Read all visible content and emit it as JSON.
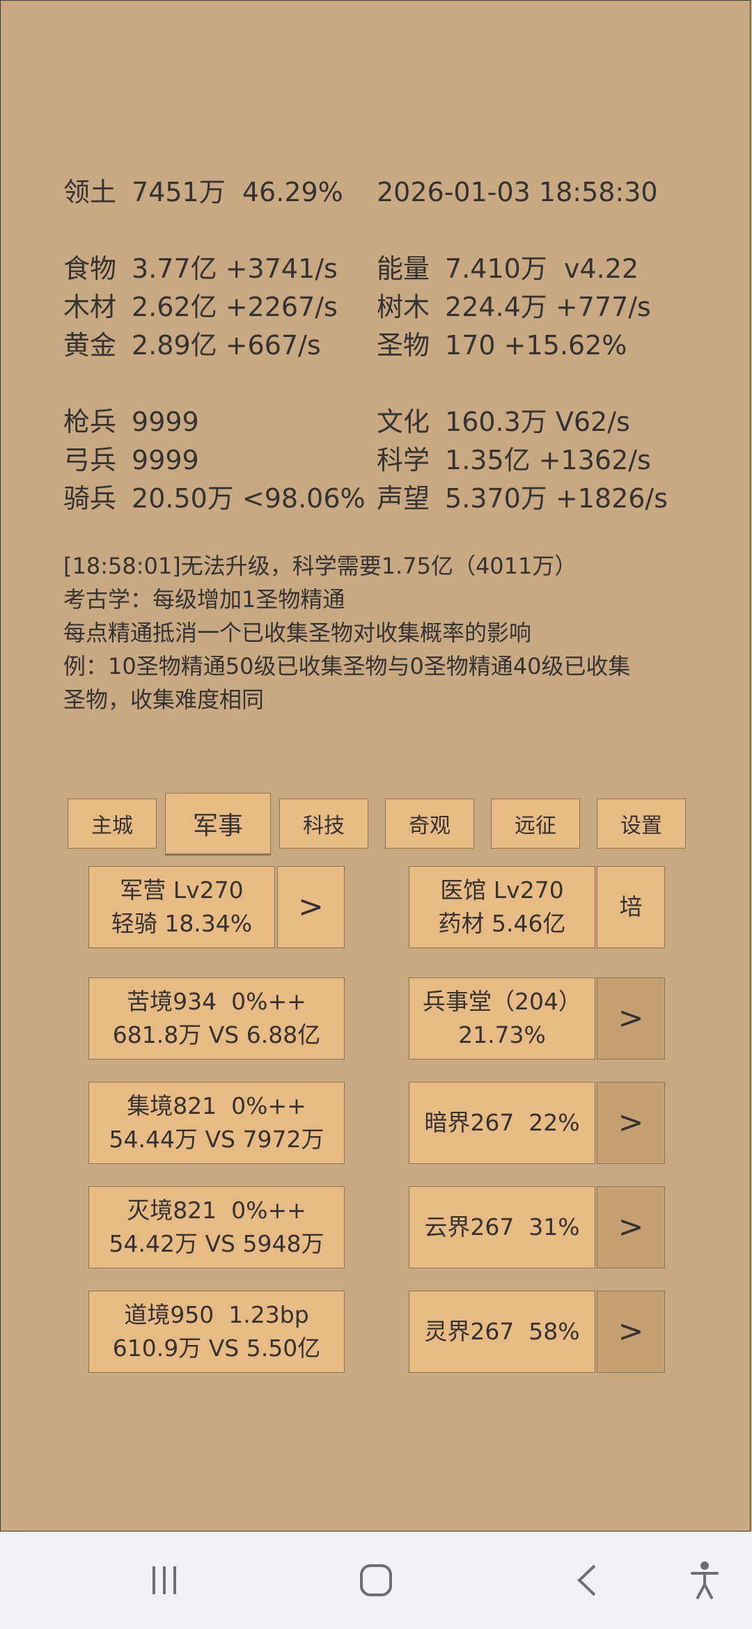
{
  "stats": {
    "territory": {
      "label": "领土",
      "value": "7451万  46.29%"
    },
    "datetime": "2026-01-03 18:58:30",
    "food": {
      "label": "食物",
      "value": "3.77亿 +3741/s"
    },
    "energy": {
      "label": "能量",
      "value": "7.410万  v4.22"
    },
    "wood": {
      "label": "木材",
      "value": "2.62亿 +2267/s"
    },
    "trees": {
      "label": "树木",
      "value": "224.4万 +777/s"
    },
    "gold": {
      "label": "黄金",
      "value": "2.89亿 +667/s"
    },
    "relics": {
      "label": "圣物",
      "value": "170 +15.62%"
    },
    "spearmen": {
      "label": "枪兵",
      "value": "9999"
    },
    "culture": {
      "label": "文化",
      "value": "160.3万 V62/s"
    },
    "archers": {
      "label": "弓兵",
      "value": "9999"
    },
    "science": {
      "label": "科学",
      "value": "1.35亿 +1362/s"
    },
    "cavalry": {
      "label": "骑兵",
      "value": "20.50万 <98.06%"
    },
    "prestige": {
      "label": "声望",
      "value": "5.370万 +1826/s"
    }
  },
  "message": [
    "[18:58:01]无法升级，科学需要1.75亿（4011万）",
    "考古学：每级增加1圣物精通",
    "每点精通抵消一个已收集圣物对收集概率的影响",
    "例：10圣物精通50级已收集圣物与0圣物精通40级已收集",
    "圣物，收集难度相同"
  ],
  "tabs": [
    "主城",
    "军事",
    "科技",
    "奇观",
    "远征",
    "设置"
  ],
  "active_tab": "军事",
  "military": {
    "barracks": "军营 Lv270\n轻骑 18.34%",
    "barracks_arrow": ">",
    "clinic": "医馆 Lv270\n药材 5.46亿",
    "clinic_action": "培",
    "realm1": "苦境934  0%++\n681.8万 VS 6.88亿",
    "hall": "兵事堂（204）\n21.73%",
    "realm2": "集境821  0%++\n54.44万 VS 7972万",
    "dark": "暗界267  22%",
    "realm3": "灭境821  0%++\n54.42万 VS 5948万",
    "cloud": "云界267  31%",
    "realm4": "道境950  1.23bp\n610.9万 VS 5.50亿",
    "spirit": "灵界267  58%",
    "arrow": ">"
  },
  "navbar": {
    "icons": [
      "recent-apps-icon",
      "home-icon",
      "back-icon",
      "accessibility-icon"
    ],
    "bg": "#f2f2f4"
  },
  "colors": {
    "background": "#c9a981",
    "button": "#e9bb84",
    "button_dark": "#c69f72",
    "text": "#333333"
  }
}
